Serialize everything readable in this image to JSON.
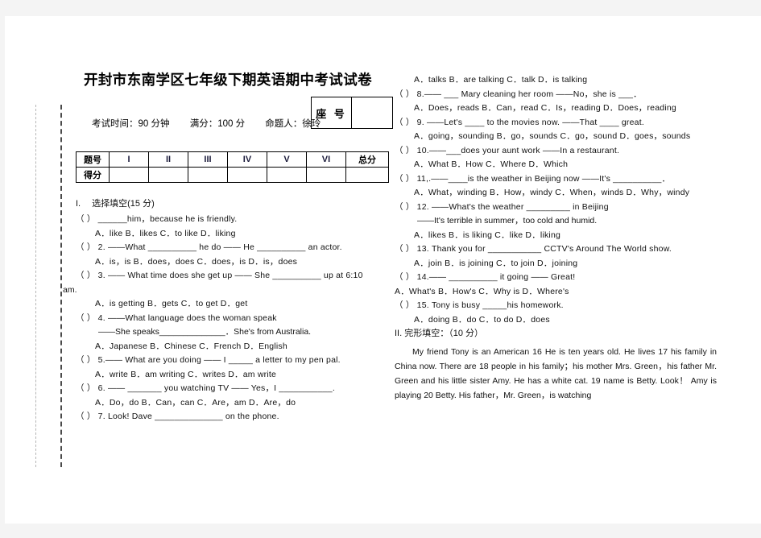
{
  "header": {
    "title": "开封市东南学区七年级下期英语期中考试试卷",
    "exam_time": "考试时间：90 分钟",
    "full_marks": "满分：100 分",
    "author": "命题人：徐玲",
    "seat_label": "座 号",
    "seat_value": ""
  },
  "score_table": {
    "row_headers": [
      "题号",
      "得分"
    ],
    "columns": [
      "I",
      "II",
      "III",
      "IV",
      "V",
      "VI"
    ],
    "total_label": "总分",
    "scores": [
      "",
      "",
      "",
      "",
      "",
      "",
      ""
    ]
  },
  "section1": {
    "number": "I.",
    "title": "选择填空(15 分)",
    "questions": [
      {
        "marker": "（  ）",
        "number": "",
        "stem": "______him，because he is friendly.",
        "options": "A．like      B．likes      C．to like      D．liking"
      },
      {
        "marker": "（ ）",
        "number": "2.",
        "stem": "——What __________ he  do      —— He __________ an actor.",
        "options": "A．is，is            B．does，does      C．does，is        D．is，does"
      },
      {
        "marker": "（ ）",
        "number": "3.",
        "stem": "—— What time does she get up      —— She __________ up at 6:10",
        "overflow": "am.",
        "options": "A．is getting      B．gets          C．to get       D．get"
      },
      {
        "marker": "（  ）",
        "number": "4.",
        "stem": "——What language does the woman speak",
        "continuation": "——She speaks______________．She's from Australia.",
        "options": "A．Japanese    B．Chinese    C．French      D．English"
      },
      {
        "marker": "（ ）",
        "number": "5.",
        "stem": "—— What are you doing      ——  I _____  a letter to my pen pal.",
        "options": "A．write       B．am writing     C．writes          D．am write"
      },
      {
        "marker": "（ ）",
        "number": "6.",
        "stem": "——  _______  you watching TV      —— Yes，I ___________.",
        "options": "A．Do，do  B．Can，can    C．Are，am      D．Are，do"
      },
      {
        "marker": "（ ）",
        "number": "7.",
        "stem": "Look! Dave ______________  on the phone.",
        "options": ""
      }
    ]
  },
  "section1_right": {
    "q7_options": "A．talks   B．are talking    C．talk         D．is talking",
    "questions": [
      {
        "marker": "（ ）",
        "number": "8.",
        "stem": "—— ___  Mary cleaning her room      ——No，she is ___．",
        "options": "A．Does，reads B．Can，read     C．Is，reading D．Does，reading"
      },
      {
        "marker": "（ ）",
        "number": "9.",
        "stem": "——Let's ____ to the movies now.    ——That ____ great.",
        "options": "A．going，sounding     B．go，sounds  C．go，sound D．goes，sounds"
      },
      {
        "marker": "（ ）",
        "number": "10.",
        "stem": "——___does your aunt work          ——In a restaurant.",
        "options": "A．What      B．How    C．Where      D．Which"
      },
      {
        "marker": "（ ）",
        "number": "11,.",
        "stem": "——____is the weather in Beijing now        ——It's __________．",
        "options": "A．What，winding  B．How，windy      C．When，winds    D．Why，windy"
      },
      {
        "marker": "（ ）",
        "number": "12.",
        "stem": "——What's the weather _________ in Beijing",
        "continuation": "——It's terrible in summer，too cold and humid.",
        "options": "A．likes   B．is liking  C．like    D．liking"
      },
      {
        "marker": "（ ）",
        "number": "13.",
        "stem": "Thank you for ___________ CCTV's Around The World show.",
        "options": "A．join    B．is joining C．to join     D．joining"
      },
      {
        "marker": "（ ）",
        "number": "14.",
        "stem": "—— __________ it going    —— Great!",
        "options": "A．What's B．How's C．Why is D．Where's"
      },
      {
        "marker": "（ ）",
        "number": "15.",
        "stem": "Tony is busy _____his homework.",
        "options": "A．doing     B．do      C．to do      D．does"
      }
    ]
  },
  "section2": {
    "number": "II.",
    "title": "完形填空：（10 分）",
    "passage": "My friend Tony is an American 16  He is ten years old. He lives 17   his family in China now. There are 18    people in his family；his mother Mrs. Green，his father Mr. Green and his little sister Amy. He has a white cat. 19   name is Betty. Look！ Amy is playing 20   Betty. His father，Mr. Green，is watching"
  }
}
